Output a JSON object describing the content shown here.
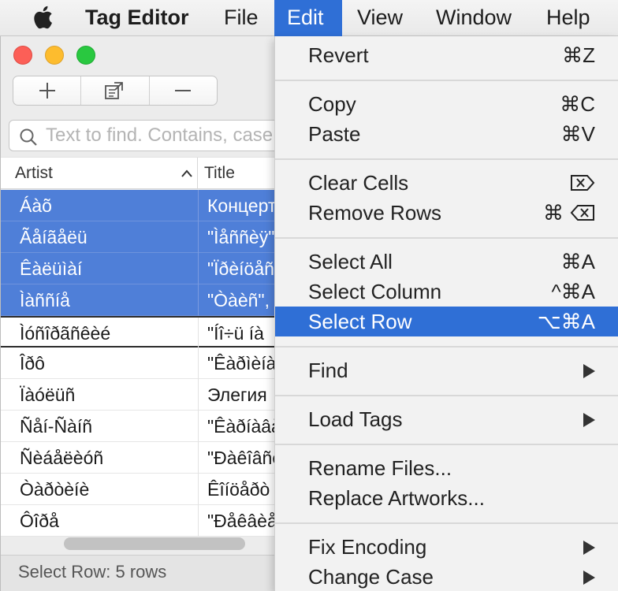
{
  "menubar": {
    "app_name": "Tag Editor",
    "menus": [
      "File",
      "Edit",
      "View",
      "Window",
      "Help"
    ],
    "active_menu": "Edit"
  },
  "window": {
    "toolbar": {
      "add": "+",
      "remove": "—"
    },
    "search": {
      "placeholder": "Text to find. Contains, case insensitive"
    },
    "columns": {
      "artist": "Artist",
      "title": "Title"
    },
    "rows": [
      {
        "artist": "Áàõ",
        "title": "Концерт",
        "selected": true
      },
      {
        "artist": "Ãåíãåëü",
        "title": "\"Ìåññèÿ\"",
        "selected": true
      },
      {
        "artist": "Êàëüìàí",
        "title": "\"Ïðèíöåññà\"",
        "selected": true
      },
      {
        "artist": "Ìàññíå",
        "title": "\"Òàèñ\", ",
        "selected": true
      },
      {
        "artist": "Ìóñîðãñêèé",
        "title": "\"Íî÷ü íà",
        "selected": false,
        "focused": true
      },
      {
        "artist": "Îðô",
        "title": "\"Êàðìèíà\"",
        "selected": false
      },
      {
        "artist": "Ïàóëüñ",
        "title": "Элегия",
        "selected": false
      },
      {
        "artist": "Ñåí-Ñàíñ",
        "title": "\"Êàðíàâàë\"",
        "selected": false
      },
      {
        "artist": "Ñèáåëèóñ",
        "title": "\"Ðàêîâñêèé\"",
        "selected": false
      },
      {
        "artist": "Òàðòèíè",
        "title": "Êîíöåðò",
        "selected": false
      },
      {
        "artist": "Ôîðå",
        "title": "\"Ðåêâèåì\"",
        "selected": false
      }
    ],
    "status": "Select Row: 5 rows"
  },
  "edit_menu": {
    "revert": {
      "label": "Revert",
      "shortcut": "⌘Z"
    },
    "copy": {
      "label": "Copy",
      "shortcut": "⌘C"
    },
    "paste": {
      "label": "Paste",
      "shortcut": "⌘V"
    },
    "clear_cells": {
      "label": "Clear Cells"
    },
    "remove_rows": {
      "label": "Remove Rows",
      "shortcut": "⌘"
    },
    "select_all": {
      "label": "Select All",
      "shortcut": "⌘A"
    },
    "select_column": {
      "label": "Select Column",
      "shortcut": "^⌘A"
    },
    "select_row": {
      "label": "Select Row",
      "shortcut": "⌥⌘A"
    },
    "find": {
      "label": "Find"
    },
    "load_tags": {
      "label": "Load Tags"
    },
    "rename_files": {
      "label": "Rename Files..."
    },
    "replace_artworks": {
      "label": "Replace Artworks..."
    },
    "fix_encoding": {
      "label": "Fix Encoding"
    },
    "change_case": {
      "label": "Change Case"
    }
  },
  "colors": {
    "accent": "#2f6fd6",
    "selection": "#4f7fd8"
  }
}
